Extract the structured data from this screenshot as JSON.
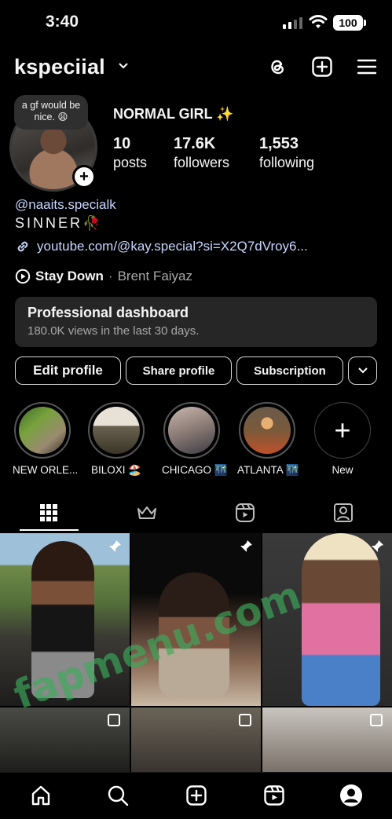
{
  "status_bar": {
    "time": "3:40",
    "battery": "100"
  },
  "header": {
    "username": "kspeciial",
    "icons": [
      "threads-icon",
      "create-icon",
      "menu-icon"
    ]
  },
  "profile": {
    "note": "a gf would be nice. 😩",
    "display_name": "NORMAL GIRL ✨",
    "stats": [
      {
        "value": "10",
        "label": "posts"
      },
      {
        "value": "17.6K",
        "label": "followers"
      },
      {
        "value": "1,553",
        "label": "following"
      }
    ],
    "handle": "@naaits.specialk",
    "bio": "SINNER🥀",
    "link": "youtube.com/@kay.special?si=X2Q7dVroy6...",
    "music": {
      "song": "Stay Down",
      "separator": " · ",
      "artist": "Brent Faiyaz"
    }
  },
  "dashboard": {
    "title": "Professional dashboard",
    "subtitle": "180.0K views in the last 30 days."
  },
  "buttons": {
    "edit": "Edit profile",
    "share": "Share profile",
    "subscription": "Subscription"
  },
  "highlights": [
    {
      "label": "NEW ORLE...",
      "colors": [
        "#3f6a2a",
        "#9a8a70"
      ]
    },
    {
      "label": "BILOXI 🏖️",
      "colors": [
        "#e8e2d6",
        "#6a6250"
      ]
    },
    {
      "label": "CHICAGO 🌃",
      "colors": [
        "#c9b7b0",
        "#3a3a44"
      ]
    },
    {
      "label": "ATLANTA 🌃",
      "colors": [
        "#7a5a3a",
        "#c0502a"
      ]
    },
    {
      "label": "New"
    }
  ],
  "tabs": [
    "grid-icon",
    "crown-icon",
    "reels-icon",
    "tagged-icon"
  ],
  "watermark": "fapmenu.com",
  "nav": [
    "home-icon",
    "search-icon",
    "create-icon",
    "reels-icon",
    "profile-icon"
  ]
}
